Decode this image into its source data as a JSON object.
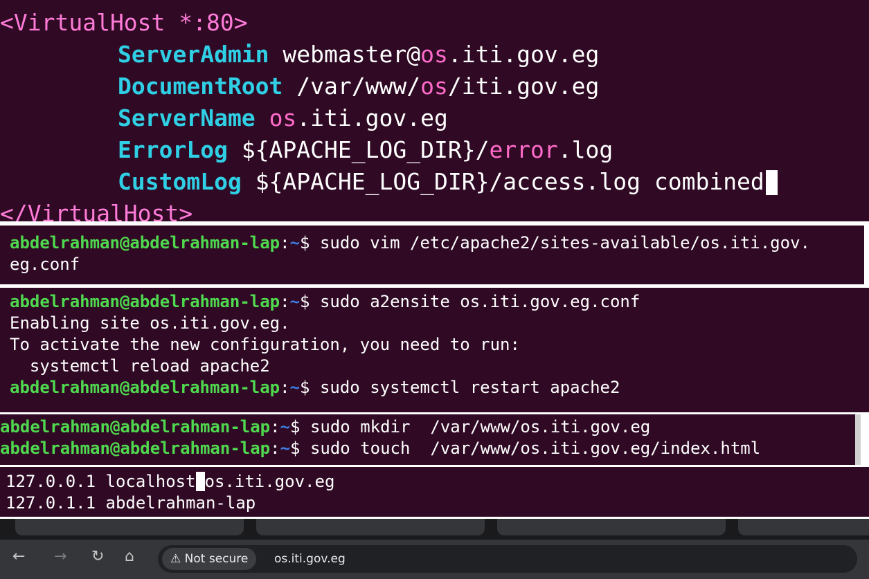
{
  "vhost": {
    "open_tag": "<VirtualHost *:80>",
    "server_admin": {
      "key": "ServerAdmin",
      "v1": "webmaster@",
      "v2": "os",
      "v3": ".iti.gov.eg"
    },
    "document_root": {
      "key": "DocumentRoot",
      "v1": "/var/www/",
      "v2": "os",
      "v3": "/iti.gov.eg"
    },
    "server_name": {
      "key": "ServerName",
      "v1": "os",
      "v2": ".iti.gov.eg"
    },
    "error_log": {
      "key": "ErrorLog",
      "v1": "${APACHE_LOG_DIR}/",
      "v2": "error",
      "v3": ".log"
    },
    "custom_log": {
      "key": "CustomLog",
      "v1": "${APACHE_LOG_DIR}/access.log combined"
    },
    "close_tag": "</VirtualHost>"
  },
  "terminal1": {
    "prompt_user": "abdelrahman@abdelrahman-lap",
    "prompt_sep": ":",
    "prompt_dir": "~",
    "prompt_sym": "$ ",
    "command": "sudo vim /etc/apache2/sites-available/os.iti.gov.",
    "command_wrap": "eg.conf"
  },
  "terminal2": {
    "prompt_user": "abdelrahman@abdelrahman-lap",
    "prompt_sep": ":",
    "prompt_dir": "~",
    "prompt_sym": "$ ",
    "command1": "sudo a2ensite os.iti.gov.eg.conf",
    "output": [
      "Enabling site os.iti.gov.eg.",
      "To activate the new configuration, you need to run:",
      "  systemctl reload apache2"
    ],
    "command2": "sudo systemctl restart apache2"
  },
  "terminal3": {
    "prompt_user": "abdelrahman@abdelrahman-lap",
    "prompt_sep": ":",
    "prompt_dir": "~",
    "prompt_sym": "$ ",
    "command1": "sudo mkdir  /var/www/os.iti.gov.eg",
    "command2": "sudo touch  /var/www/os.iti.gov.eg/index.html"
  },
  "hosts": {
    "line1_a": "127.0.0.1 localhost",
    "line1_b": "os.iti.gov.eg",
    "line2": "127.0.1.1 abdelrahman-lap"
  },
  "browser": {
    "security_label": "Not secure",
    "url": "os.iti.gov.eg",
    "icons": {
      "back": "arrow-left-icon",
      "forward": "arrow-right-icon",
      "reload": "reload-icon",
      "home": "home-icon",
      "warning": "warning-triangle-icon"
    }
  },
  "colors": {
    "terminal_bg": "#300a24",
    "prompt_user": "#4fd94f",
    "prompt_dir": "#3d7be0",
    "vim_keyword": "#2fd0e6",
    "vim_tag": "#ff7bd8",
    "browser_bg": "#35363a"
  }
}
